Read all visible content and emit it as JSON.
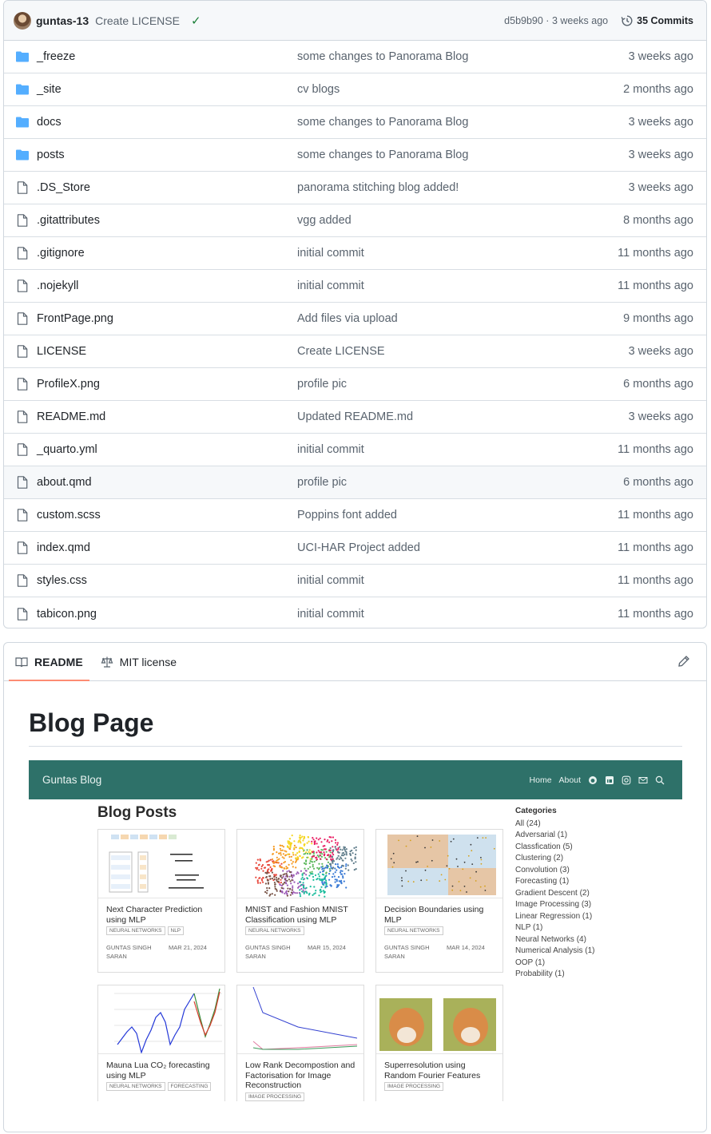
{
  "commit": {
    "author": "guntas-13",
    "message": "Create LICENSE",
    "sha_age": "d5b9b90 · 3 weeks ago",
    "commits_label": "35 Commits"
  },
  "files": [
    {
      "name": "_freeze",
      "type": "folder",
      "message": "some changes to Panorama Blog",
      "age": "3 weeks ago"
    },
    {
      "name": "_site",
      "type": "folder",
      "message": "cv blogs",
      "age": "2 months ago"
    },
    {
      "name": "docs",
      "type": "folder",
      "message": "some changes to Panorama Blog",
      "age": "3 weeks ago"
    },
    {
      "name": "posts",
      "type": "folder",
      "message": "some changes to Panorama Blog",
      "age": "3 weeks ago"
    },
    {
      "name": ".DS_Store",
      "type": "file",
      "message": "panorama stitching blog added!",
      "age": "3 weeks ago"
    },
    {
      "name": ".gitattributes",
      "type": "file",
      "message": "vgg added",
      "age": "8 months ago"
    },
    {
      "name": ".gitignore",
      "type": "file",
      "message": "initial commit",
      "age": "11 months ago"
    },
    {
      "name": ".nojekyll",
      "type": "file",
      "message": "initial commit",
      "age": "11 months ago"
    },
    {
      "name": "FrontPage.png",
      "type": "file",
      "message": "Add files via upload",
      "age": "9 months ago"
    },
    {
      "name": "LICENSE",
      "type": "file",
      "message": "Create LICENSE",
      "age": "3 weeks ago"
    },
    {
      "name": "ProfileX.png",
      "type": "file",
      "message": "profile pic",
      "age": "6 months ago"
    },
    {
      "name": "README.md",
      "type": "file",
      "message": "Updated README.md",
      "age": "3 weeks ago"
    },
    {
      "name": "_quarto.yml",
      "type": "file",
      "message": "initial commit",
      "age": "11 months ago"
    },
    {
      "name": "about.qmd",
      "type": "file",
      "message": "profile pic",
      "age": "6 months ago"
    },
    {
      "name": "custom.scss",
      "type": "file",
      "message": "Poppins font added",
      "age": "11 months ago"
    },
    {
      "name": "index.qmd",
      "type": "file",
      "message": "UCI-HAR Project added",
      "age": "11 months ago"
    },
    {
      "name": "styles.css",
      "type": "file",
      "message": "initial commit",
      "age": "11 months ago"
    },
    {
      "name": "tabicon.png",
      "type": "file",
      "message": "initial commit",
      "age": "11 months ago"
    }
  ],
  "readme": {
    "tab_readme": "README",
    "tab_license": "MIT license",
    "title": "Blog Page"
  },
  "blog": {
    "brand": "Guntas Blog",
    "nav_home": "Home",
    "nav_about": "About",
    "posts_title": "Blog Posts",
    "cards": [
      {
        "title": "Next Character Prediction using MLP",
        "tags": [
          "NEURAL NETWORKS",
          "NLP"
        ],
        "author": "GUNTAS SINGH SARAN",
        "date": "MAR 21, 2024"
      },
      {
        "title": "MNIST and Fashion MNIST Classification using MLP",
        "tags": [
          "NEURAL NETWORKS"
        ],
        "author": "GUNTAS SINGH SARAN",
        "date": "MAR 15, 2024"
      },
      {
        "title": "Decision Boundaries using MLP",
        "tags": [
          "NEURAL NETWORKS"
        ],
        "author": "GUNTAS SINGH SARAN",
        "date": "MAR 14, 2024"
      },
      {
        "title": "Mauna Lua CO₂ forecasting using MLP",
        "tags": [
          "NEURAL NETWORKS",
          "FORECASTING"
        ],
        "author": "",
        "date": ""
      },
      {
        "title": "Low Rank Decompostion and Factorisation for Image Reconstruction",
        "tags": [
          "IMAGE PROCESSING"
        ],
        "author": "",
        "date": ""
      },
      {
        "title": "Superresolution using Random Fourier Features",
        "tags": [
          "IMAGE PROCESSING"
        ],
        "author": "",
        "date": ""
      }
    ],
    "categories_title": "Categories",
    "categories": [
      "All (24)",
      "Adversarial (1)",
      "Classfication (5)",
      "Clustering (2)",
      "Convolution (3)",
      "Forecasting (1)",
      "Gradient Descent (2)",
      "Image Processing (3)",
      "Linear Regression (1)",
      "NLP (1)",
      "Neural Networks (4)",
      "Numerical Analysis (1)",
      "OOP (1)",
      "Probability (1)"
    ]
  },
  "colors": {
    "folder": "#54aeff",
    "navbar": "#2e7169",
    "check": "#1a7f37",
    "tab_underline": "#fd8c73"
  }
}
